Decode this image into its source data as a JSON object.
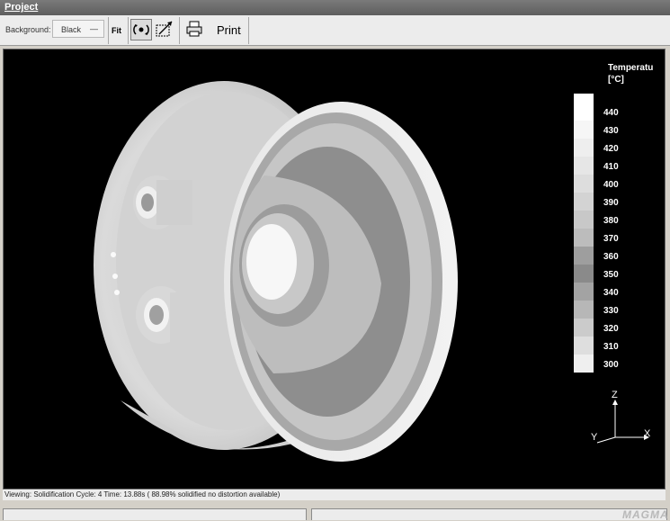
{
  "window": {
    "title": "Project"
  },
  "toolbar": {
    "background_label": "Background:",
    "background_value": "Black",
    "fit_label": "Fit",
    "print_label": "Print",
    "icons": [
      "rotate-view-icon",
      "zoom-region-icon",
      "printer-icon"
    ]
  },
  "legend": {
    "title_line1": "Temperatu",
    "title_line2": "[°C]",
    "values": [
      "440",
      "430",
      "420",
      "410",
      "400",
      "390",
      "380",
      "370",
      "360",
      "350",
      "340",
      "330",
      "320",
      "310",
      "300"
    ],
    "colors": [
      "#ffffff",
      "#f6f6f6",
      "#eeeeee",
      "#e6e6e6",
      "#dddddd",
      "#d3d3d3",
      "#c8c8c8",
      "#bcbcbc",
      "#9e9e9e",
      "#8a8a8a",
      "#a3a3a3",
      "#b7b7b7",
      "#cbcbcb",
      "#dedede",
      "#efefef"
    ]
  },
  "axes": {
    "z": "Z",
    "y": "Y",
    "x": "X"
  },
  "status": {
    "text": "Viewing: Solidification Cycle: 4  Time: 13.88s ( 88.98% solidified no distortion available)"
  },
  "footer": {
    "logo": "MAGMA"
  }
}
